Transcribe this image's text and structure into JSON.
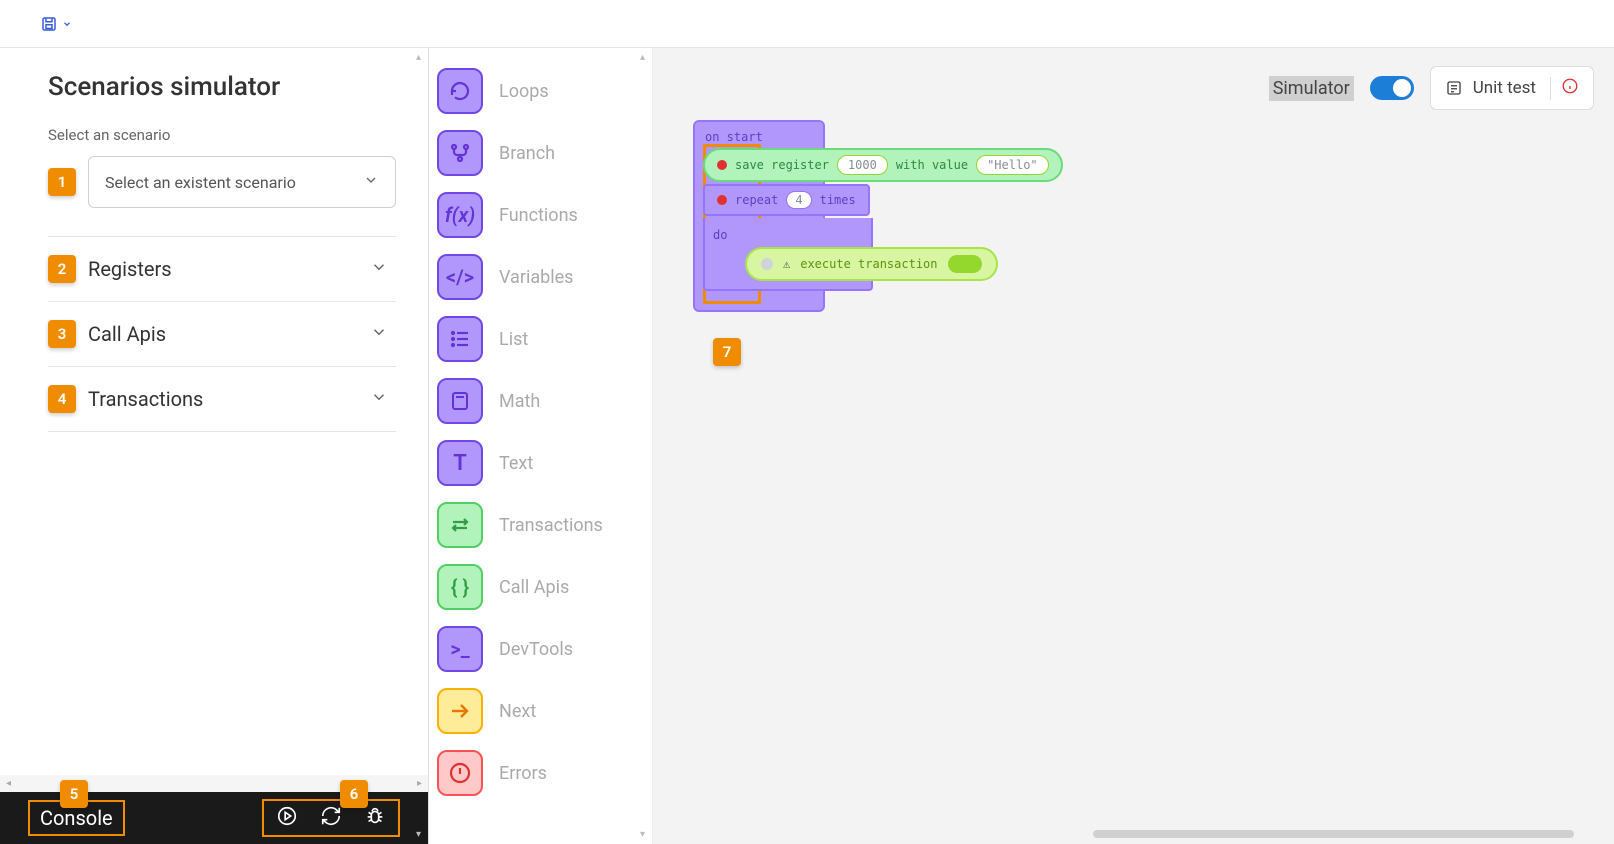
{
  "sidebar": {
    "title": "Scenarios simulator",
    "select_label": "Select an scenario",
    "select_placeholder": "Select an existent scenario",
    "accordion": [
      {
        "badge": "2",
        "title": "Registers"
      },
      {
        "badge": "3",
        "title": "Call Apis"
      },
      {
        "badge": "4",
        "title": "Transactions"
      }
    ],
    "badge1": "1",
    "badge5": "5",
    "badge6": "6",
    "console": "Console"
  },
  "toolbox": [
    {
      "icon": "loops",
      "color": "purple",
      "label": "Loops"
    },
    {
      "icon": "branch",
      "color": "purple",
      "label": "Branch"
    },
    {
      "icon": "fx",
      "color": "purple",
      "label": "Functions"
    },
    {
      "icon": "vars",
      "color": "purple",
      "label": "Variables"
    },
    {
      "icon": "list",
      "color": "purple",
      "label": "List"
    },
    {
      "icon": "math",
      "color": "purple",
      "label": "Math"
    },
    {
      "icon": "text",
      "color": "purple",
      "label": "Text"
    },
    {
      "icon": "trans",
      "color": "green",
      "label": "Transactions"
    },
    {
      "icon": "call",
      "color": "green",
      "label": "Call Apis"
    },
    {
      "icon": "dev",
      "color": "purple",
      "label": "DevTools"
    },
    {
      "icon": "next",
      "color": "yellow",
      "label": "Next"
    },
    {
      "icon": "err",
      "color": "red",
      "label": "Errors"
    }
  ],
  "header": {
    "sim_label": "Simulator",
    "unit_test": "Unit test"
  },
  "blocks": {
    "on_start": "on start",
    "save_left": "save register",
    "save_val": "1000",
    "save_mid": "with value",
    "save_right": "\"Hello\"",
    "repeat_left": "repeat",
    "repeat_val": "4",
    "repeat_right": "times",
    "do": "do",
    "exec": "execute transaction",
    "badge7": "7"
  }
}
